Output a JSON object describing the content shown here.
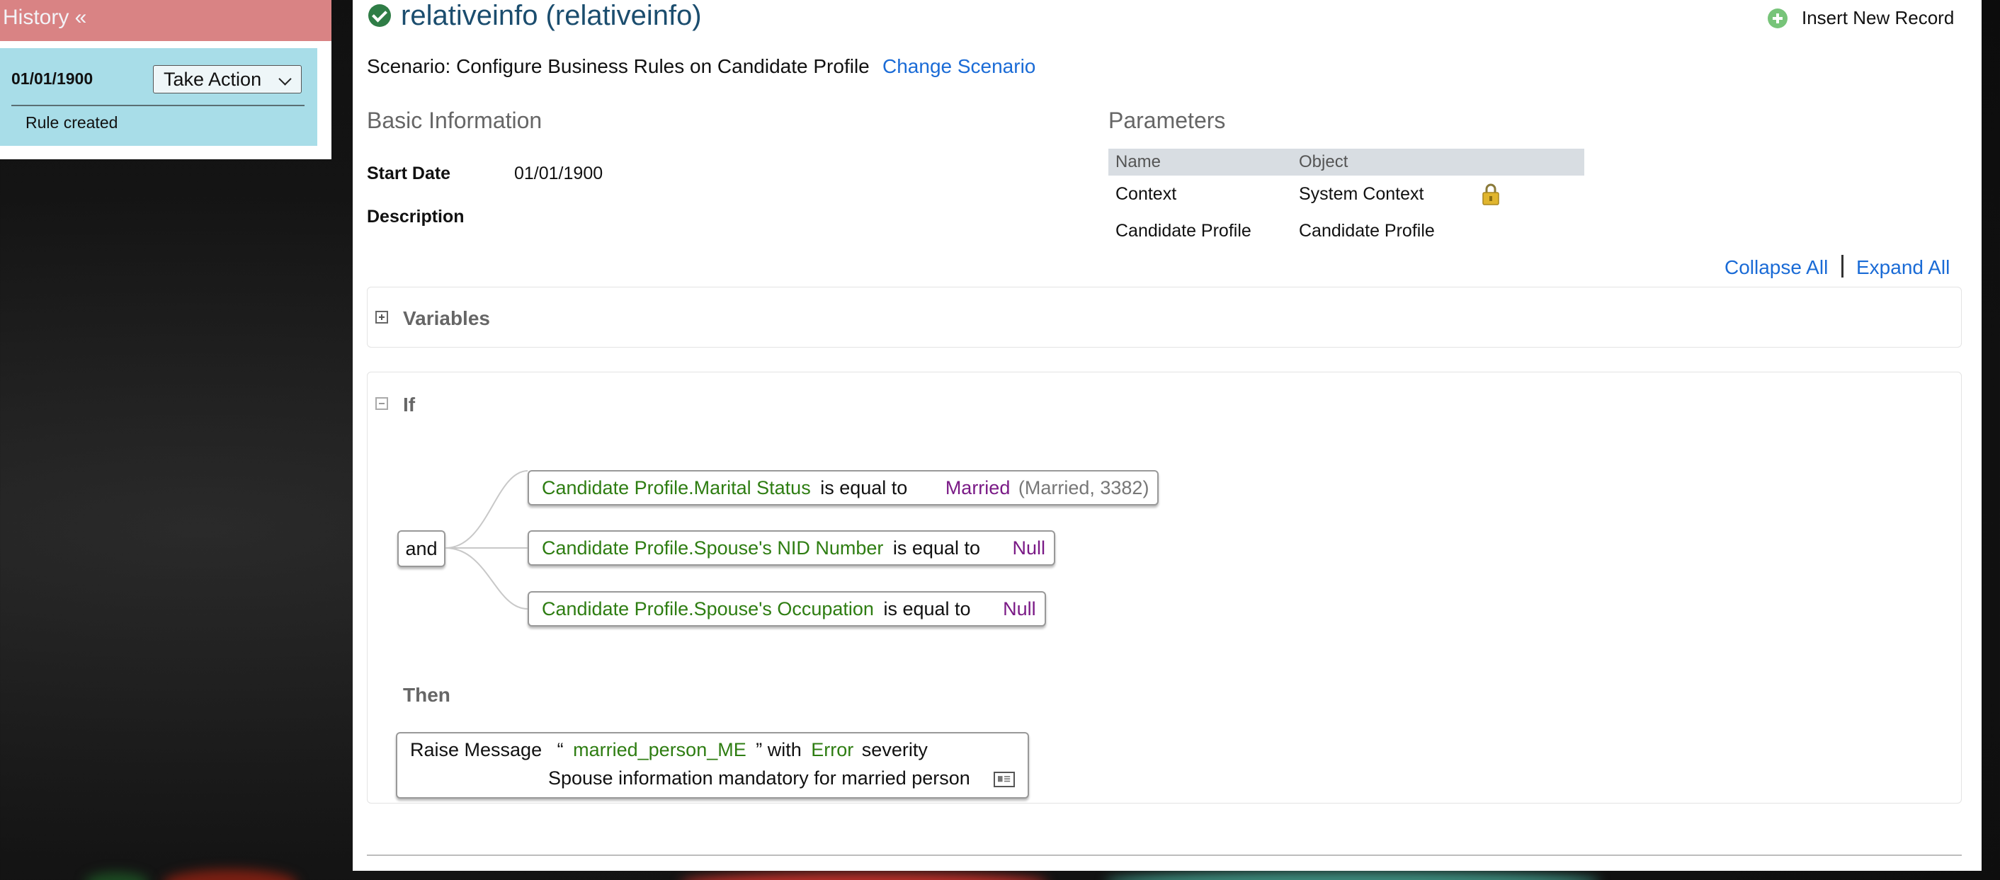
{
  "history": {
    "title": "History «",
    "entries": [
      {
        "date": "01/01/1900",
        "action_label": "Take Action",
        "note": "Rule created"
      }
    ]
  },
  "header": {
    "title": "relativeinfo (relativeinfo)",
    "insert_label": "Insert New Record"
  },
  "scenario": {
    "text": "Scenario: Configure Business Rules on Candidate Profile",
    "change_label": "Change Scenario"
  },
  "basic_info": {
    "heading": "Basic Information",
    "start_date_label": "Start Date",
    "start_date_value": "01/01/1900",
    "description_label": "Description"
  },
  "parameters": {
    "heading": "Parameters",
    "columns": [
      "Name",
      "Object"
    ],
    "rows": [
      {
        "name": "Context",
        "object": "System Context",
        "locked": true
      },
      {
        "name": "Candidate Profile",
        "object": "Candidate Profile",
        "locked": false
      }
    ]
  },
  "controls": {
    "collapse_all": "Collapse All",
    "expand_all": "Expand All"
  },
  "variables": {
    "title": "Variables",
    "expanded": false
  },
  "if_block": {
    "title": "If",
    "operator": "and",
    "conditions": [
      {
        "field": "Candidate Profile.Marital Status",
        "op": "is equal to",
        "value": "Married",
        "extra": "(Married, 3382)"
      },
      {
        "field": "Candidate Profile.Spouse's NID Number",
        "op": "is equal to",
        "value": "Null",
        "extra": ""
      },
      {
        "field": "Candidate Profile.Spouse's Occupation",
        "op": "is equal to",
        "value": "Null",
        "extra": ""
      }
    ]
  },
  "then_block": {
    "title": "Then",
    "raise_label": "Raise Message",
    "open_quote": "“",
    "message_key": "married_person_ME",
    "close_with": "” with",
    "severity": "Error",
    "severity_suffix": "severity",
    "message_text": "Spouse information mandatory for married person"
  },
  "colors": {
    "history_header": "#d98384",
    "history_entry": "#a8dde8",
    "link": "#1a6bd6",
    "field_green": "#2e7d12",
    "value_purple": "#7a1a86",
    "title_blue": "#1b4d6e"
  }
}
